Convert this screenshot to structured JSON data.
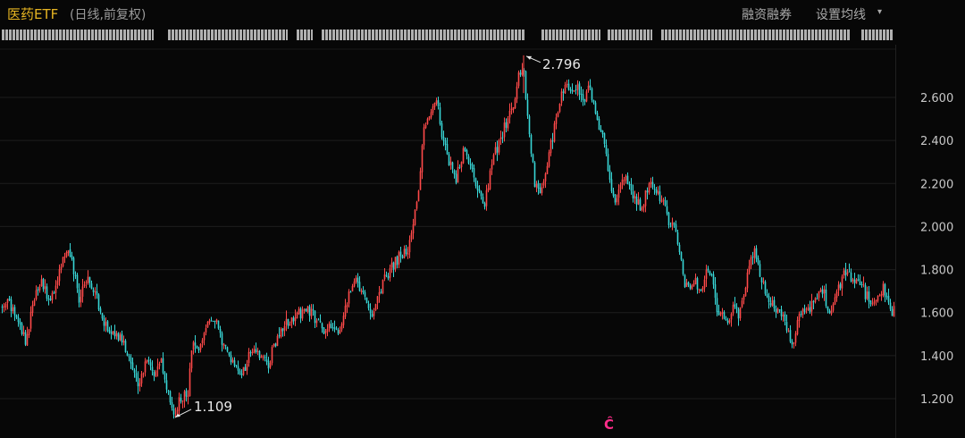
{
  "header": {
    "title": "医药ETF",
    "subtitle": "(日线,前复权)",
    "margin_label": "融资融券",
    "settings_label": "设置均线",
    "settings_caret": "▾"
  },
  "colors": {
    "background": "#070707",
    "up": "#ff4a4a",
    "down": "#38d6d6",
    "grid": "#1e1e1e",
    "axis_text": "#c8c8c8",
    "title": "#e6b422",
    "marker": "#ff2d8a"
  },
  "marker_char": "Ĉ",
  "chart_data": {
    "type": "candlestick",
    "title": "医药ETF",
    "ylim": [
      1.08,
      2.86
    ],
    "y_ticks": [
      1.2,
      1.4,
      1.6,
      1.8,
      2.0,
      2.2,
      2.4,
      2.6
    ],
    "y_tick_labels": [
      "1.200",
      "1.400",
      "1.600",
      "1.800",
      "2.000",
      "2.200",
      "2.400",
      "2.600"
    ],
    "grid": true,
    "price_path": [
      [
        0,
        1.62
      ],
      [
        10,
        1.64
      ],
      [
        20,
        1.58
      ],
      [
        28,
        1.45
      ],
      [
        36,
        1.62
      ],
      [
        45,
        1.75
      ],
      [
        55,
        1.64
      ],
      [
        65,
        1.78
      ],
      [
        75,
        1.9
      ],
      [
        82,
        1.8
      ],
      [
        88,
        1.66
      ],
      [
        97,
        1.76
      ],
      [
        105,
        1.7
      ],
      [
        115,
        1.55
      ],
      [
        125,
        1.5
      ],
      [
        135,
        1.48
      ],
      [
        145,
        1.38
      ],
      [
        155,
        1.26
      ],
      [
        163,
        1.4
      ],
      [
        172,
        1.32
      ],
      [
        180,
        1.38
      ],
      [
        187,
        1.24
      ],
      [
        194,
        1.12
      ],
      [
        202,
        1.2
      ],
      [
        210,
        1.24
      ],
      [
        215,
        1.47
      ],
      [
        222,
        1.42
      ],
      [
        230,
        1.54
      ],
      [
        240,
        1.58
      ],
      [
        248,
        1.48
      ],
      [
        255,
        1.4
      ],
      [
        262,
        1.36
      ],
      [
        270,
        1.32
      ],
      [
        280,
        1.42
      ],
      [
        288,
        1.4
      ],
      [
        295,
        1.38
      ],
      [
        300,
        1.32
      ],
      [
        305,
        1.45
      ],
      [
        315,
        1.52
      ],
      [
        325,
        1.56
      ],
      [
        335,
        1.6
      ],
      [
        345,
        1.62
      ],
      [
        355,
        1.55
      ],
      [
        362,
        1.52
      ],
      [
        370,
        1.54
      ],
      [
        380,
        1.52
      ],
      [
        390,
        1.7
      ],
      [
        398,
        1.75
      ],
      [
        408,
        1.68
      ],
      [
        415,
        1.58
      ],
      [
        425,
        1.7
      ],
      [
        435,
        1.8
      ],
      [
        445,
        1.85
      ],
      [
        455,
        1.88
      ],
      [
        462,
        2.02
      ],
      [
        468,
        2.18
      ],
      [
        474,
        2.45
      ],
      [
        480,
        2.52
      ],
      [
        488,
        2.6
      ],
      [
        495,
        2.4
      ],
      [
        502,
        2.3
      ],
      [
        510,
        2.22
      ],
      [
        518,
        2.35
      ],
      [
        526,
        2.28
      ],
      [
        534,
        2.18
      ],
      [
        542,
        2.1
      ],
      [
        550,
        2.3
      ],
      [
        558,
        2.38
      ],
      [
        566,
        2.48
      ],
      [
        574,
        2.56
      ],
      [
        580,
        2.7
      ],
      [
        586,
        2.7
      ],
      [
        592,
        2.4
      ],
      [
        598,
        2.2
      ],
      [
        604,
        2.15
      ],
      [
        610,
        2.25
      ],
      [
        616,
        2.38
      ],
      [
        622,
        2.5
      ],
      [
        628,
        2.62
      ],
      [
        634,
        2.66
      ],
      [
        640,
        2.6
      ],
      [
        646,
        2.66
      ],
      [
        652,
        2.58
      ],
      [
        658,
        2.64
      ],
      [
        664,
        2.58
      ],
      [
        670,
        2.44
      ],
      [
        676,
        2.4
      ],
      [
        682,
        2.2
      ],
      [
        688,
        2.1
      ],
      [
        694,
        2.2
      ],
      [
        700,
        2.25
      ],
      [
        706,
        2.18
      ],
      [
        712,
        2.12
      ],
      [
        718,
        2.08
      ],
      [
        724,
        2.18
      ],
      [
        730,
        2.2
      ],
      [
        736,
        2.15
      ],
      [
        742,
        2.12
      ],
      [
        748,
        2.02
      ],
      [
        754,
        2.0
      ],
      [
        760,
        1.9
      ],
      [
        766,
        1.72
      ],
      [
        772,
        1.72
      ],
      [
        778,
        1.76
      ],
      [
        784,
        1.7
      ],
      [
        790,
        1.78
      ],
      [
        796,
        1.76
      ],
      [
        802,
        1.62
      ],
      [
        808,
        1.58
      ],
      [
        814,
        1.55
      ],
      [
        820,
        1.62
      ],
      [
        826,
        1.6
      ],
      [
        832,
        1.68
      ],
      [
        838,
        1.84
      ],
      [
        844,
        1.88
      ],
      [
        850,
        1.78
      ],
      [
        856,
        1.7
      ],
      [
        862,
        1.65
      ],
      [
        868,
        1.62
      ],
      [
        874,
        1.6
      ],
      [
        880,
        1.52
      ],
      [
        886,
        1.44
      ],
      [
        892,
        1.56
      ],
      [
        898,
        1.6
      ],
      [
        904,
        1.62
      ],
      [
        910,
        1.66
      ],
      [
        916,
        1.7
      ],
      [
        922,
        1.68
      ],
      [
        928,
        1.6
      ],
      [
        934,
        1.66
      ],
      [
        940,
        1.74
      ],
      [
        946,
        1.8
      ],
      [
        952,
        1.76
      ],
      [
        958,
        1.74
      ],
      [
        964,
        1.72
      ],
      [
        970,
        1.68
      ],
      [
        976,
        1.62
      ],
      [
        982,
        1.68
      ],
      [
        988,
        1.72
      ],
      [
        994,
        1.62
      ],
      [
        1000,
        1.6
      ]
    ],
    "annotations": [
      {
        "label": "2.796",
        "value": 2.796
      },
      {
        "label": "1.109",
        "value": 1.109
      }
    ]
  }
}
